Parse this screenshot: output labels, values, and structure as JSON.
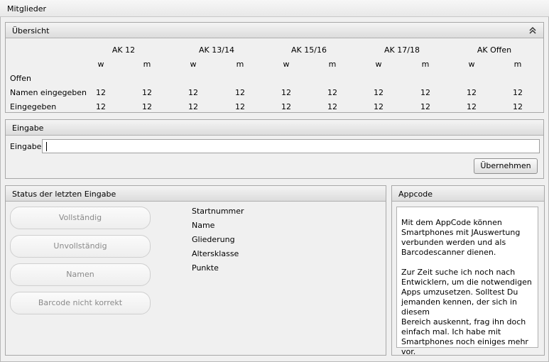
{
  "window": {
    "title": "Mitglieder"
  },
  "overview": {
    "title": "Übersicht",
    "groups": [
      "AK 12",
      "AK 13/14",
      "AK 15/16",
      "AK 17/18",
      "AK Offen"
    ],
    "subheaders": [
      "w",
      "m"
    ],
    "rows": [
      {
        "label": "Offen",
        "values": [
          "",
          "",
          "",
          "",
          "",
          "",
          "",
          "",
          "",
          ""
        ]
      },
      {
        "label": "Namen eingegeben",
        "values": [
          "12",
          "12",
          "12",
          "12",
          "12",
          "12",
          "12",
          "12",
          "12",
          "12"
        ]
      },
      {
        "label": "Eingegeben",
        "values": [
          "12",
          "12",
          "12",
          "12",
          "12",
          "12",
          "12",
          "12",
          "12",
          "12"
        ]
      }
    ]
  },
  "entry": {
    "title": "Eingabe",
    "label": "Eingabe",
    "value": "",
    "button": "Übernehmen"
  },
  "status": {
    "title": "Status der letzten Eingabe",
    "buttons": [
      "Vollständig",
      "Unvollständig",
      "Namen",
      "Barcode nicht korrekt"
    ],
    "fields": [
      "Startnummer",
      "Name",
      "Gliederung",
      "Altersklasse",
      "Punkte"
    ]
  },
  "appcode": {
    "title": "Appcode",
    "text": "Mit dem AppCode können\nSmartphones mit JAuswertung\nverbunden werden und als\nBarcodescanner dienen.\n\nZur Zeit suche ich noch nach\nEntwicklern, um die notwendigen\nApps umzusetzen. Solltest Du\njemanden kennen, der sich in diesem\nBereich auskennt, frag ihn doch\neinfach mal. Ich habe mit\nSmartphones noch einiges mehr vor."
  }
}
